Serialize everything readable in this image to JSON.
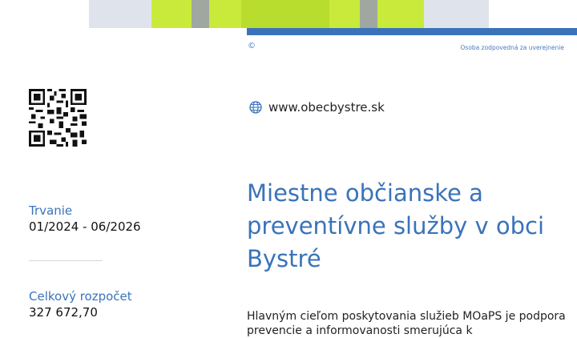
{
  "header": {
    "copyright_symbol": "©",
    "responsible_person": "Osoba zodpovedná za uverejnenie"
  },
  "contact": {
    "website_icon": "globe-icon",
    "website": "www.obecbystre.sk"
  },
  "sidebar": {
    "duration_label": "Trvanie",
    "duration_value": "01/2024 - 06/2026",
    "budget_label": "Celkový rozpočet",
    "budget_value": "327 672,70"
  },
  "main": {
    "title": "Miestne občianske a preventívne služby v obci Bystré",
    "description": "Hlavným cieľom poskytovania služieb MOaPS je podpora prevencie a informovanosti smerujúca k"
  },
  "colors": {
    "accent": "#3a73ba",
    "text": "#222222"
  }
}
